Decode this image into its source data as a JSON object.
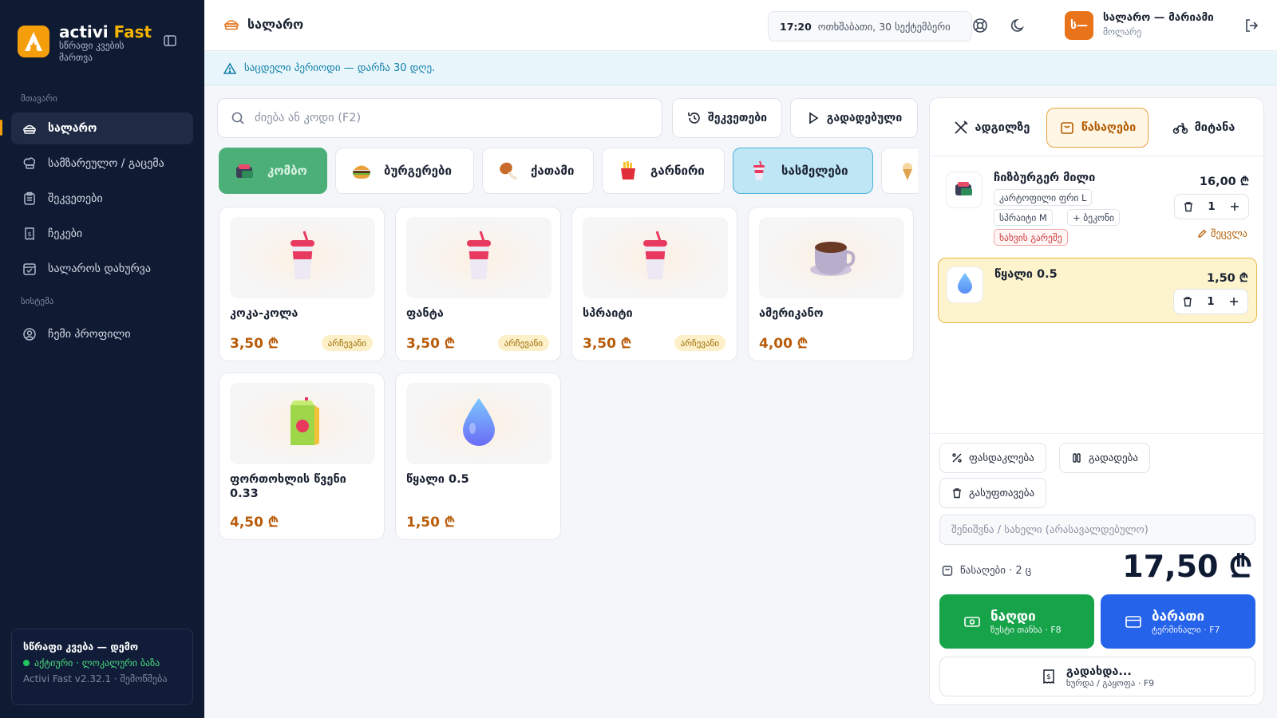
{
  "brand": {
    "name": "activi",
    "name_accent": "Fast",
    "tagline": "სწრაფი კვების მართვა",
    "logo_letter": "A"
  },
  "sidebar": {
    "group_main": "მთავარი",
    "group_system": "სისტემა",
    "items": [
      {
        "label": "სალარო",
        "icon": "till-icon",
        "active": true
      },
      {
        "label": "სამზარეულო / გაცემა",
        "icon": "chef-hat-icon"
      },
      {
        "label": "შეკვეთები",
        "icon": "clipboard-icon"
      },
      {
        "label": "ჩეკები",
        "icon": "receipt-icon"
      },
      {
        "label": "სალაროს დახურვა",
        "icon": "calendar-check-icon"
      }
    ],
    "system_items": [
      {
        "label": "ჩემი პროფილი",
        "icon": "user-circle-icon"
      }
    ],
    "footer": {
      "title": "სწრაფი კვება — დემო",
      "status": "აქტიური · ლოკალური ბაზა",
      "version": "Activi Fast v2.32.1 · შემოწმება"
    }
  },
  "topbar": {
    "title": "სალარო",
    "time": "17:20",
    "date": "ოთხშაბათი, 30 სექტემბერი",
    "user": {
      "name": "სალარო — მარიამი",
      "role": "მოლარე",
      "avatar": "ს—"
    }
  },
  "banner": {
    "text": "საცდელი პერიოდი — დარჩა 30 დღე."
  },
  "search": {
    "placeholder": "ძიება ან კოდი (F2)"
  },
  "toolbar": {
    "orders_label": "შეკვეთები",
    "deferred_label": "გადადებული"
  },
  "categories": [
    {
      "label": "კომბო",
      "icon": "combo-icon"
    },
    {
      "label": "ბურგერები",
      "icon": "burger-icon"
    },
    {
      "label": "ქათამი",
      "icon": "chicken-leg-icon"
    },
    {
      "label": "გარნირი",
      "icon": "fries-icon"
    },
    {
      "label": "სასმელები",
      "icon": "drink-cup-icon"
    },
    {
      "label": "",
      "icon": "ice-cream-icon"
    }
  ],
  "products": [
    {
      "name": "კოკა-კოლა",
      "price": "3,50 ₾",
      "badge": "არჩევანი",
      "icon": "drink-cup-icon"
    },
    {
      "name": "ფანტა",
      "price": "3,50 ₾",
      "badge": "არჩევანი",
      "icon": "drink-cup-icon"
    },
    {
      "name": "სპრაიტი",
      "price": "3,50 ₾",
      "badge": "არჩევანი",
      "icon": "drink-cup-icon"
    },
    {
      "name": "ამერიკანო",
      "price": "4,00 ₾",
      "badge": "",
      "icon": "coffee-cup-icon"
    },
    {
      "name": "ფორთოხლის წვენი 0.33",
      "price": "4,50 ₾",
      "badge": "",
      "icon": "juice-box-icon"
    },
    {
      "name": "წყალი 0.5",
      "price": "1,50 ₾",
      "badge": "",
      "icon": "water-drop-icon"
    }
  ],
  "order": {
    "tabs": [
      {
        "label": "ადგილზე",
        "icon": "cutlery-icon"
      },
      {
        "label": "წასაღები",
        "icon": "bag-icon",
        "active": true
      },
      {
        "label": "მიტანა",
        "icon": "bike-icon"
      }
    ],
    "items": [
      {
        "name": "ჩიზბურგერ მილი",
        "price": "16,00 ₾",
        "qty": "1",
        "mods": [
          "კარტოფილი ფრი L",
          "სპრაიტი M",
          "+ ბეკონი"
        ],
        "warning": "ხახვის გარეშე",
        "edit_label": "შეცვლა"
      },
      {
        "name": "წყალი 0.5",
        "price": "1,50 ₾",
        "qty": "1"
      }
    ],
    "actions": {
      "discount": "ფასდაკლება",
      "defer": "გადადება",
      "clear": "გასუფთავება"
    },
    "note_placeholder": "შენიშვნა / სახელი (არასავალდებულო)",
    "summary": "წასაღები · 2 ც",
    "total": "17,50 ₾",
    "cash": {
      "label": "ნაღდი",
      "hint": "ზუსტი თანხა · F8"
    },
    "card": {
      "label": "ბარათი",
      "hint": "ტერმინალი · F7"
    },
    "split": {
      "label": "გადახდა...",
      "hint": "ხურდა / გაყოფა · F9"
    }
  },
  "colors": {
    "sidebar_bg": "#0f1a33",
    "accent": "#f59e0b",
    "price": "#b85c0a",
    "cash": "#16a34a",
    "card": "#2563eb"
  }
}
